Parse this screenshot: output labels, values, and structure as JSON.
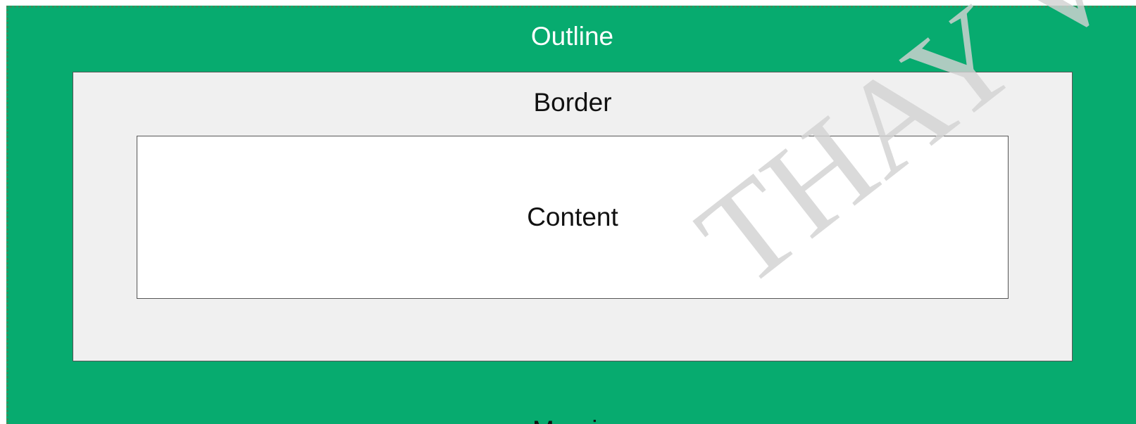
{
  "diagram": {
    "outline_label": "Outline",
    "border_label": "Border",
    "content_label": "Content",
    "margin_label": "Margin"
  },
  "watermark": {
    "text": "THAY VU"
  },
  "colors": {
    "outline_fill": "#07ab6f",
    "border_fill": "#f0f0f0",
    "content_fill": "#ffffff"
  }
}
